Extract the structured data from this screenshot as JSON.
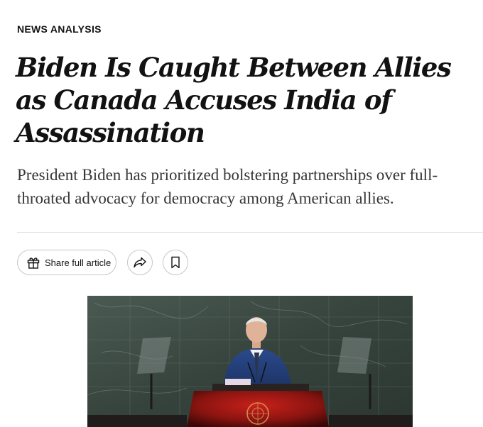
{
  "article": {
    "kicker": "NEWS ANALYSIS",
    "headline": "Biden Is Caught Between Allies as Canada Accuses India of Assassination",
    "summary": "President Biden has prioritized bolstering partnerships over full-throated advocacy for democracy among American allies."
  },
  "toolbar": {
    "share_label": "Share full article",
    "share_icon": "gift-icon",
    "forward_icon": "share-arrow-icon",
    "bookmark_icon": "bookmark-icon"
  },
  "photo": {
    "subject": "photo-president-at-podium"
  },
  "colors": {
    "text": "#121212",
    "summary_text": "#363636",
    "border": "#c7c7c7",
    "rule": "#dfdfdf",
    "podium_red": "#8a1410",
    "marble": "#3e4a44"
  }
}
